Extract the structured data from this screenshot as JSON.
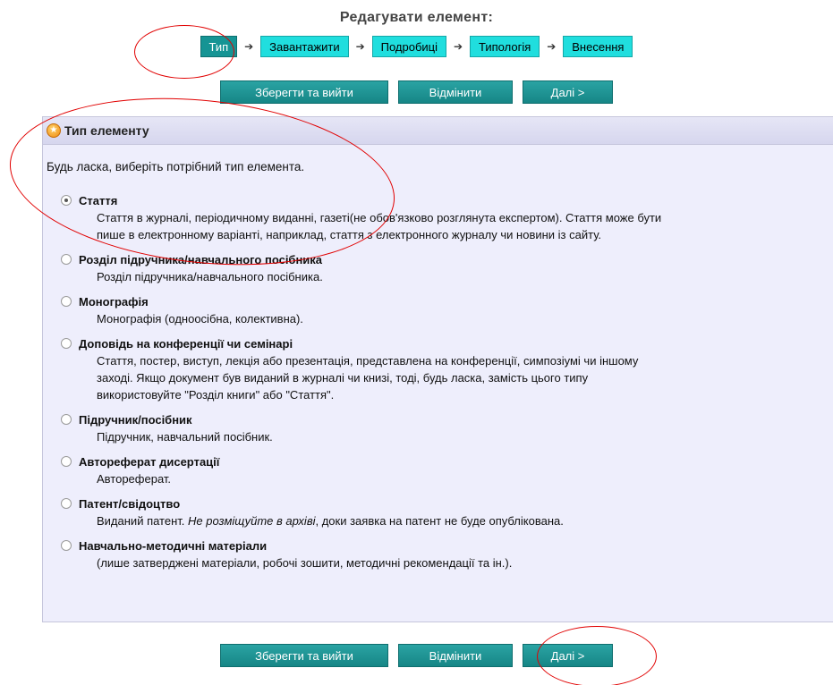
{
  "header": {
    "title": "Редагувати елемент:"
  },
  "wizard": {
    "steps": [
      {
        "label": "Тип",
        "active": true
      },
      {
        "label": "Завантажити",
        "active": false
      },
      {
        "label": "Подробиці",
        "active": false
      },
      {
        "label": "Типологія",
        "active": false
      },
      {
        "label": "Внесення",
        "active": false
      }
    ],
    "arrow_symbol": "➔"
  },
  "buttons": {
    "save_exit": "Зберегти та вийти",
    "cancel": "Відмінити",
    "next": "Далі >"
  },
  "panel": {
    "title": "Тип елементу",
    "icon": "star-icon",
    "intro": "Будь ласка, виберіть потрібний тип елемента.",
    "selected_index": 0,
    "options": [
      {
        "title": "Стаття",
        "desc_lines": [
          "Стаття в журналі, періодичному виданні, газеті(не обов'язково розглянута експертом). Стаття може бути",
          "пише в електронному варіанті, наприклад, стаття з електронного журналу чи новини із сайту."
        ]
      },
      {
        "title": "Розділ підручника/навчального посібника",
        "desc_lines": [
          "Розділ підручника/навчального посібника."
        ]
      },
      {
        "title": "Монографія",
        "desc_lines": [
          "Монографія (одноосібна, колективна)."
        ]
      },
      {
        "title": "Доповідь на конференції чи семінарі",
        "desc_lines": [
          "Стаття, постер, виступ, лекція або презентація, представлена на конференції, симпозіумі чи іншому",
          "заході. Якщо документ був виданий в журналі чи книзі, тоді, будь ласка, замість цього типу",
          "використовуйте \"Розділ книги\" або \"Стаття\"."
        ]
      },
      {
        "title": "Підручник/посібник",
        "desc_lines": [
          "Підручник, навчальний посібник."
        ]
      },
      {
        "title": "Автореферат дисертації",
        "desc_lines": [
          "Автореферат."
        ]
      },
      {
        "title": "Патент/свідоцтво",
        "desc_parts": {
          "pre": "Виданий патент. ",
          "em": "Не розміщуйте в архіві",
          "post": ", доки заявка на патент не буде опублікована."
        }
      },
      {
        "title": "Навчально-методичні матеріали",
        "desc_lines": [
          "(лише затверджені матеріали, робочі зошити, методичні рекомендації та ін.)."
        ]
      }
    ]
  },
  "colors": {
    "step_bg": "#20dede",
    "step_active_bg": "#159494",
    "button_bg": "#1a8c8c",
    "panel_bg": "#eeeefc",
    "annotation": "#e10000"
  }
}
